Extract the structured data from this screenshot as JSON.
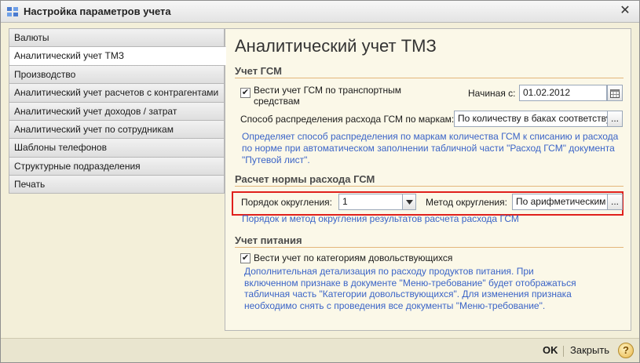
{
  "window": {
    "title": "Настройка параметров учета",
    "close_glyph": "✕"
  },
  "sidebar": {
    "items": [
      {
        "label": "Валюты"
      },
      {
        "label": "Аналитический учет ТМЗ"
      },
      {
        "label": "Производство"
      },
      {
        "label": "Аналитический учет расчетов с контрагентами"
      },
      {
        "label": "Аналитический учет доходов / затрат"
      },
      {
        "label": "Аналитический учет по сотрудникам"
      },
      {
        "label": "Шаблоны телефонов"
      },
      {
        "label": "Структурные подразделения"
      },
      {
        "label": "Печать"
      }
    ],
    "active_index": 1
  },
  "panel": {
    "title": "Аналитический учет ТМЗ",
    "gsm": {
      "section_title": "Учет ГСМ",
      "vehicle_checkbox_label": "Вести учет ГСМ по транспортным средствам",
      "vehicle_checked": true,
      "start_date_label": "Начиная с:",
      "start_date_value": "01.02.2012",
      "method_label": "Способ распределения расхода ГСМ по маркам:",
      "method_value": "По количеству в баках соответству",
      "method_hint": "Определяет способ распределения по маркам количества ГСМ к списанию и расхода по норме при автоматическом заполнении табличной части \"Расход ГСМ\" документа \"Путевой лист\"."
    },
    "norm": {
      "section_title": "Расчет нормы расхода ГСМ",
      "rounding_order_label": "Порядок округления:",
      "rounding_order_value": "1",
      "rounding_method_label": "Метод округления:",
      "rounding_method_value": "По арифметическим п",
      "hint": "Порядок и метод округления результатов расчета расхода ГСМ"
    },
    "food": {
      "section_title": "Учет питания",
      "category_checkbox_label": "Вести учет по категориям довольствующихся",
      "category_checked": true,
      "hint": "Дополнительная детализация по расходу продуктов питания. При включенном признаке в документе \"Меню-требование\" будет отображаться табличная часть \"Категории довольствующихся\". Для изменения признака необходимо снять с проведения все документы \"Меню-требование\"."
    }
  },
  "footer": {
    "ok_label": "OK",
    "close_label": "Закрыть",
    "help_label": "?"
  },
  "colors": {
    "accent_red": "#e0201c",
    "hint_blue": "#3b64c7",
    "section_line": "#e3b67a"
  }
}
